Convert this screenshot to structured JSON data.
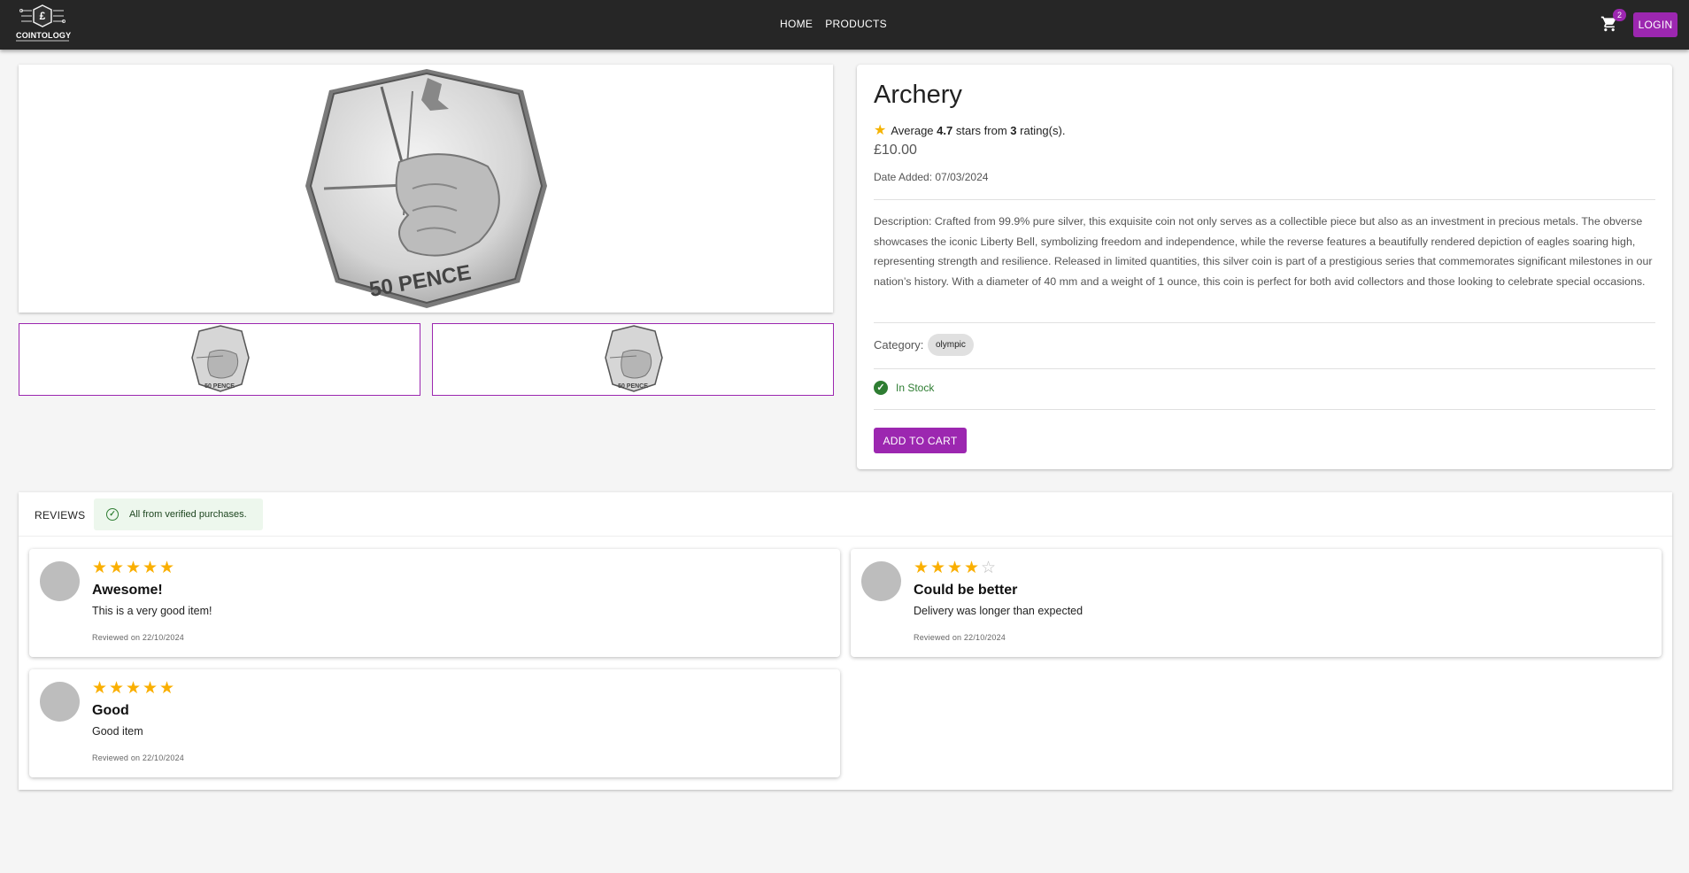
{
  "header": {
    "logo_text": "COINTOLOGY",
    "nav": [
      {
        "label": "HOME"
      },
      {
        "label": "PRODUCTS"
      }
    ],
    "cart_count": "2",
    "login_label": "LOGIN"
  },
  "product": {
    "title": "Archery",
    "rating_prefix": "Average",
    "rating_value": "4.7",
    "rating_mid": "stars from",
    "rating_count": "3",
    "rating_suffix": "rating(s).",
    "price": "£10.00",
    "date_added": "Date Added: 07/03/2024",
    "description": "Description: Crafted from 99.9% pure silver, this exquisite coin not only serves as a collectible piece but also as an investment in precious metals. The obverse showcases the iconic Liberty Bell, symbolizing freedom and independence, while the reverse features a beautifully rendered depiction of eagles soaring high, representing strength and resilience. Released in limited quantities, this silver coin is part of a prestigious series that commemorates significant milestones in our nation’s history. With a diameter of 40 mm and a weight of 1 ounce, this coin is perfect for both avid collectors and those looking to celebrate special occasions.",
    "category_label": "Category:",
    "category": "olympic",
    "stock": "In Stock",
    "add_to_cart": "ADD TO CART",
    "coin_text": "50 PENCE"
  },
  "reviews": {
    "label": "REVIEWS",
    "verified": "All from verified purchases.",
    "items": [
      {
        "stars": 5,
        "title": "Awesome!",
        "body": "This is a very good item!",
        "date": "Reviewed on 22/10/2024"
      },
      {
        "stars": 4,
        "title": "Could be better",
        "body": "Delivery was longer than expected",
        "date": "Reviewed on 22/10/2024"
      },
      {
        "stars": 5,
        "title": "Good",
        "body": "Good item",
        "date": "Reviewed on 22/10/2024"
      }
    ]
  },
  "colors": {
    "accent": "#9c27b0",
    "header_bg": "#262626",
    "star": "#faaf00",
    "success": "#2e7d32"
  }
}
